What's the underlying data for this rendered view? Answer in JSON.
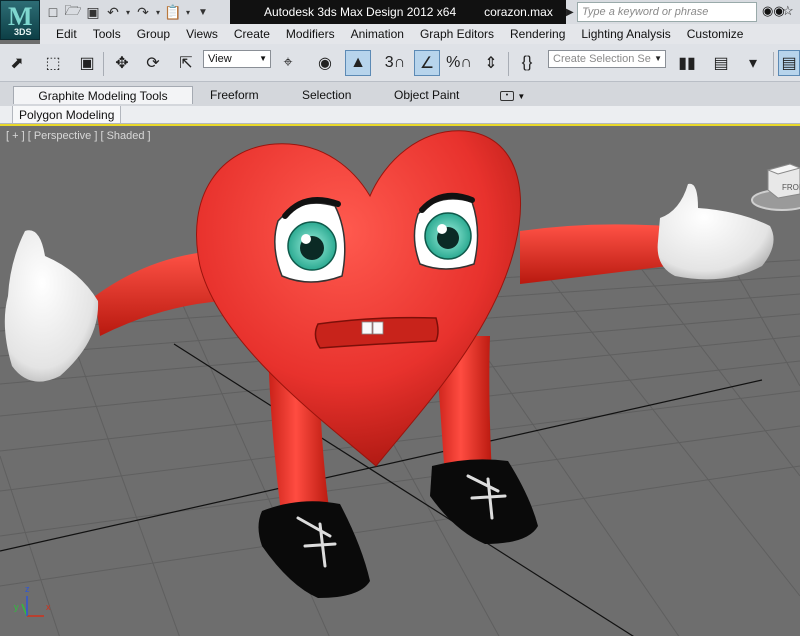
{
  "app": {
    "logo_text": "M",
    "logo_sub": "3DS",
    "title": "Autodesk 3ds Max Design 2012 x64",
    "document": "corazon.max"
  },
  "quick_access": {
    "icons": [
      "new-file-icon",
      "open-folder-icon",
      "save-icon",
      "undo-icon",
      "redo-icon",
      "project-folder-icon",
      "customize-dropdown-icon"
    ]
  },
  "search": {
    "placeholder": "Type a keyword or phrase"
  },
  "menu": {
    "items": [
      "Edit",
      "Tools",
      "Group",
      "Views",
      "Create",
      "Modifiers",
      "Animation",
      "Graph Editors",
      "Rendering",
      "Lighting Analysis",
      "Customize"
    ]
  },
  "toolbar": {
    "reference_coord": "View",
    "named_selection_placeholder": "Create Selection Se",
    "snap_label": "3",
    "percent_snap_label": "%"
  },
  "ribbon": {
    "tabs": [
      "Graphite Modeling Tools",
      "Freeform",
      "Selection",
      "Object Paint"
    ],
    "active_tab": "Graphite Modeling Tools",
    "panel": "Polygon Modeling"
  },
  "viewport": {
    "label": "[ + ] [ Perspective ] [ Shaded ]",
    "viewcube_face": "FRONT",
    "axis_x": "x",
    "axis_y": "y",
    "axis_z": "z",
    "border_color": "#e8d82a",
    "background": "#6e6e6e",
    "model_color": "#e8322d"
  }
}
